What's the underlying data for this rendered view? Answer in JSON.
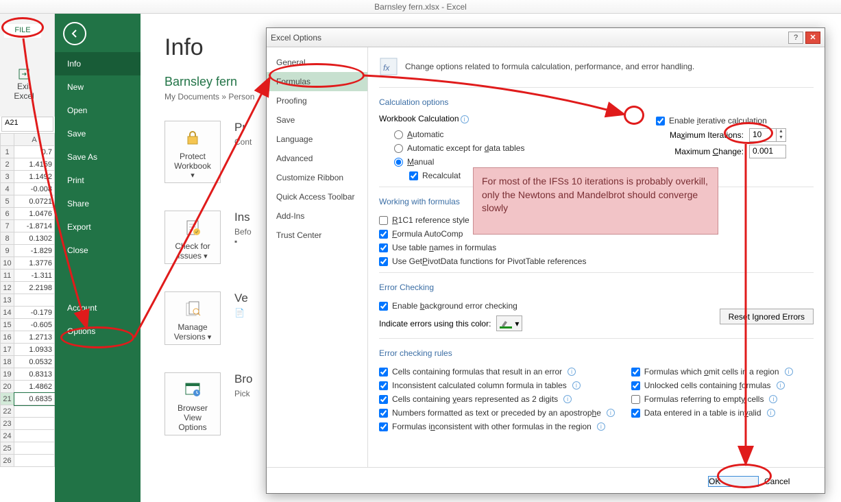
{
  "titlebar": "Barnsley fern.xlsx - Excel",
  "file_tab": "FILE",
  "exit_label": "Exit Excel",
  "namebox": "A21",
  "col_header": "A",
  "rows": [
    {
      "n": "1",
      "v": "0.7"
    },
    {
      "n": "2",
      "v": "1.4159"
    },
    {
      "n": "3",
      "v": "1.1492"
    },
    {
      "n": "4",
      "v": "-0.008"
    },
    {
      "n": "5",
      "v": "0.0721"
    },
    {
      "n": "6",
      "v": "1.0476"
    },
    {
      "n": "7",
      "v": "-1.8714"
    },
    {
      "n": "8",
      "v": "0.1302"
    },
    {
      "n": "9",
      "v": "-1.829"
    },
    {
      "n": "10",
      "v": "1.3776"
    },
    {
      "n": "11",
      "v": "-1.311"
    },
    {
      "n": "12",
      "v": "2.2198"
    },
    {
      "n": "13",
      "v": ""
    },
    {
      "n": "14",
      "v": "-0.179"
    },
    {
      "n": "15",
      "v": "-0.605"
    },
    {
      "n": "16",
      "v": "1.2713"
    },
    {
      "n": "17",
      "v": "1.0933"
    },
    {
      "n": "18",
      "v": "0.0532"
    },
    {
      "n": "19",
      "v": "0.8313"
    },
    {
      "n": "20",
      "v": "1.4862"
    },
    {
      "n": "21",
      "v": "0.6835"
    },
    {
      "n": "22",
      "v": ""
    },
    {
      "n": "23",
      "v": ""
    },
    {
      "n": "24",
      "v": ""
    },
    {
      "n": "25",
      "v": ""
    },
    {
      "n": "26",
      "v": ""
    }
  ],
  "backstage": {
    "items": [
      "Info",
      "New",
      "Open",
      "Save",
      "Save As",
      "Print",
      "Share",
      "Export",
      "Close",
      "Account",
      "Options"
    ],
    "selected": 0
  },
  "info": {
    "title": "Info",
    "docname": "Barnsley fern",
    "breadcrumb": "My Documents » Person",
    "protect_btn": "Protect Workbook",
    "protect_title": "Pr",
    "protect_sub": "Cont",
    "inspect_btn": "Check for Issues",
    "inspect_title": "Ins",
    "inspect_sub": "Befo",
    "versions_btn": "Manage Versions",
    "versions_title": "Ve",
    "browser_btn": "Browser View Options",
    "browser_title": "Bro",
    "browser_sub": "Pick"
  },
  "dialog": {
    "title": "Excel Options",
    "nav": [
      "General",
      "Formulas",
      "Proofing",
      "Save",
      "Language",
      "Advanced",
      "Customize Ribbon",
      "Quick Access Toolbar",
      "Add-Ins",
      "Trust Center"
    ],
    "nav_selected": 1,
    "headline": "Change options related to formula calculation, performance, and error handling.",
    "g_calc": "Calculation options",
    "wb_calc": "Workbook Calculation",
    "r_auto": "Automatic",
    "r_auto_dt": "Automatic except for data tables",
    "r_manual": "Manual",
    "c_recalc": "Recalculat",
    "c_iter": "Enable iterative calculation",
    "l_maxiter": "Maximum Iterations:",
    "v_maxiter": "10",
    "l_maxchg": "Maximum Change:",
    "v_maxchg": "0.001",
    "g_work": "Working with formulas",
    "c_r1c1": "R1C1 reference style",
    "c_autoc": "Formula AutoComp",
    "c_tnames": "Use table names in formulas",
    "c_pivot": "Use GetPivotData functions for PivotTable references",
    "g_errchk": "Error Checking",
    "c_bgchk": "Enable background error checking",
    "l_indcolor": "Indicate errors using this color:",
    "b_reset": "Reset Ignored Errors",
    "g_rules": "Error checking rules",
    "rule1": "Cells containing formulas that result in an error",
    "rule2": "Inconsistent calculated column formula in tables",
    "rule3": "Cells containing years represented as 2 digits",
    "rule4": "Numbers formatted as text or preceded by an apostrophe",
    "rule5": "Formulas inconsistent with other formulas in the region",
    "rule6": "Formulas which omit cells in a region",
    "rule7": "Unlocked cells containing formulas",
    "rule8": "Formulas referring to empty cells",
    "rule9": "Data entered in a table is invalid",
    "ok": "OK",
    "cancel": "Cancel"
  },
  "callout": "For most of the IFSs 10 iterations is probably overkill, only the Newtons and Mandelbrot should converge slowly"
}
